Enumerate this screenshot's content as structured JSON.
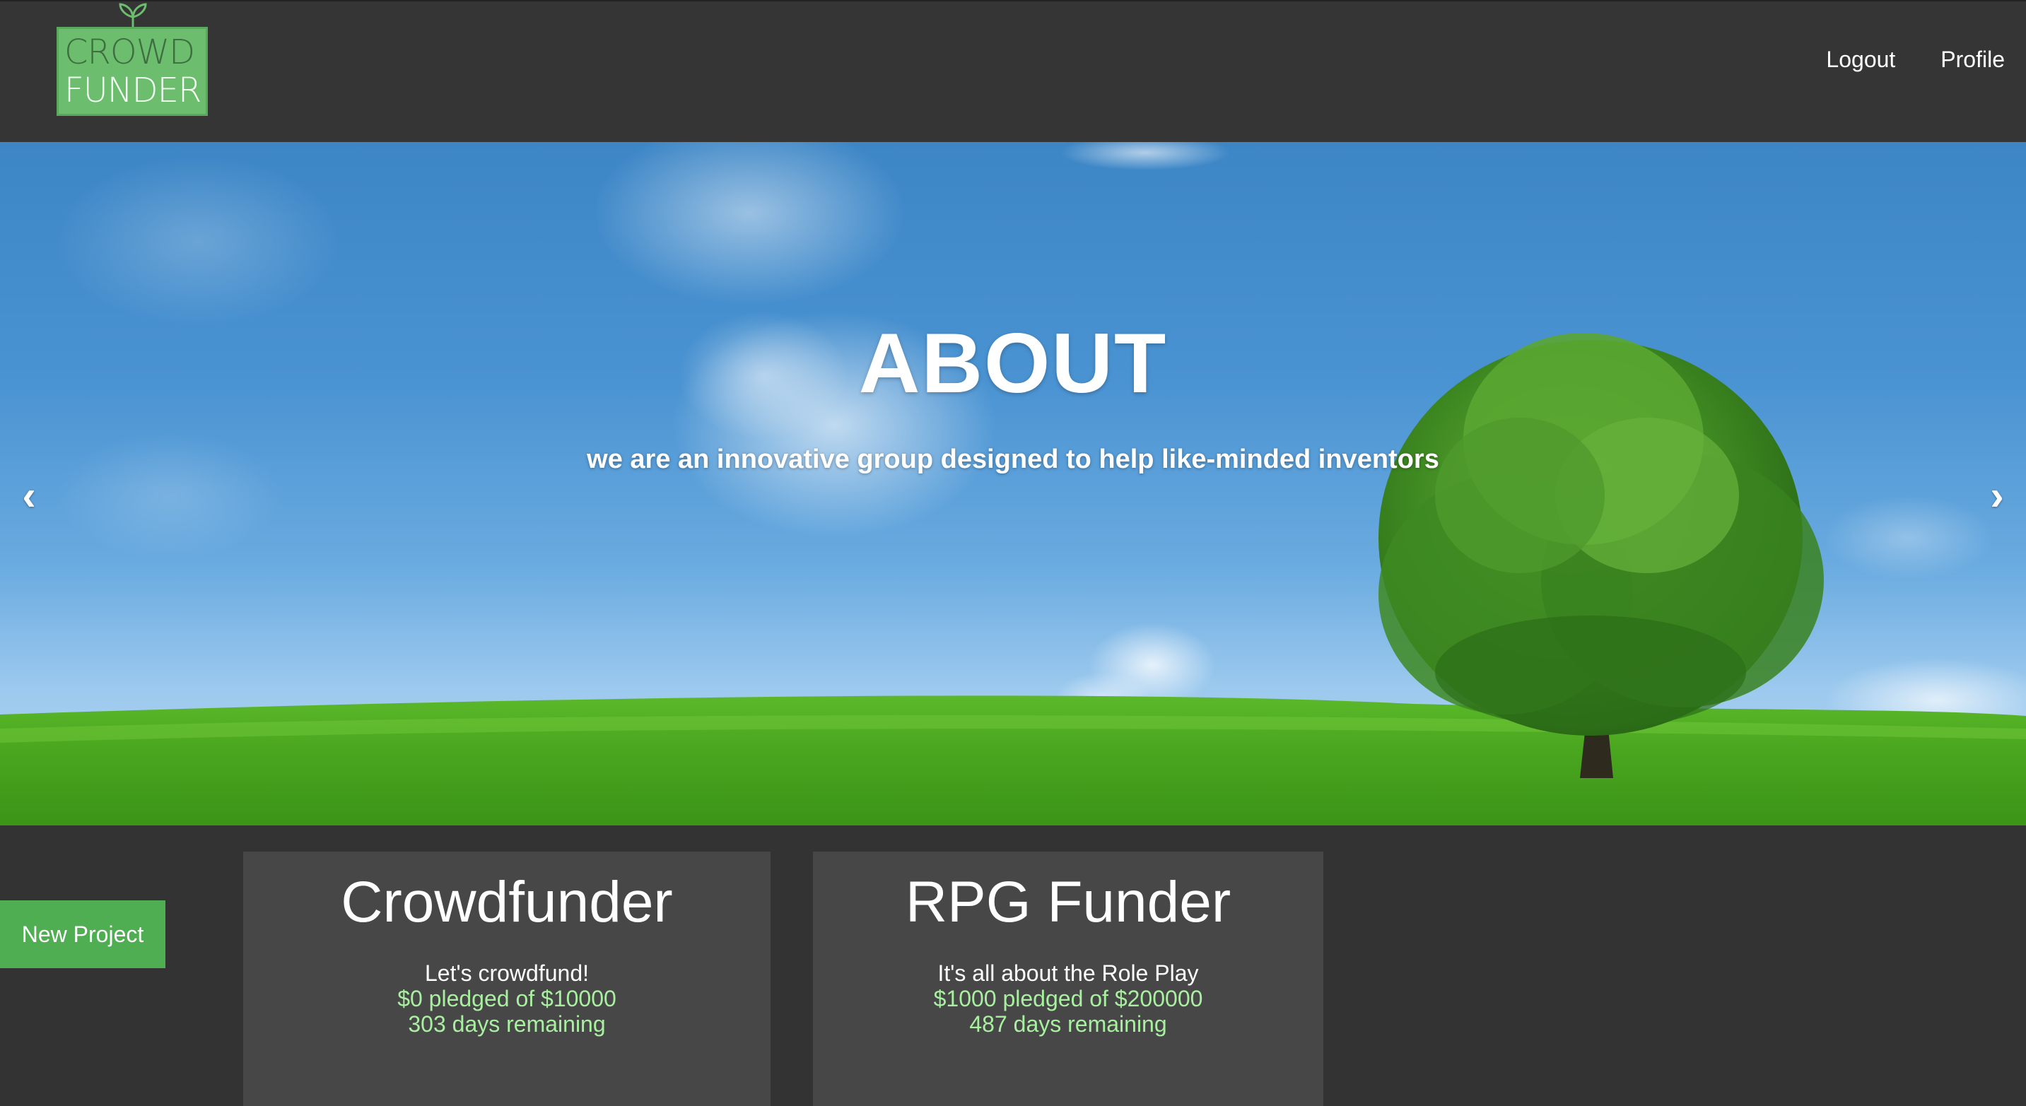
{
  "header": {
    "logo": {
      "line1": "CROWD",
      "line2": "FUNDER",
      "color": "#6cbd6e"
    },
    "nav": [
      {
        "label": "Logout"
      },
      {
        "label": "Profile"
      }
    ]
  },
  "hero": {
    "title": "ABOUT",
    "subtitle": "we are an innovative group designed to help like-minded inventors",
    "prev_arrow": "‹",
    "next_arrow": "›"
  },
  "new_project_button": {
    "label": "New Project",
    "color": "#4fae52"
  },
  "projects": [
    {
      "title": "Crowdfunder",
      "description": "Let's crowdfund!",
      "pledged": "$0 pledged of $10000",
      "remaining": "303 days remaining"
    },
    {
      "title": "RPG Funder",
      "description": "It's all about the Role Play",
      "pledged": "$1000 pledged of $200000",
      "remaining": "487 days remaining"
    }
  ],
  "colors": {
    "background": "#333333",
    "card": "#474747",
    "stat_text": "#a8f0a0"
  }
}
